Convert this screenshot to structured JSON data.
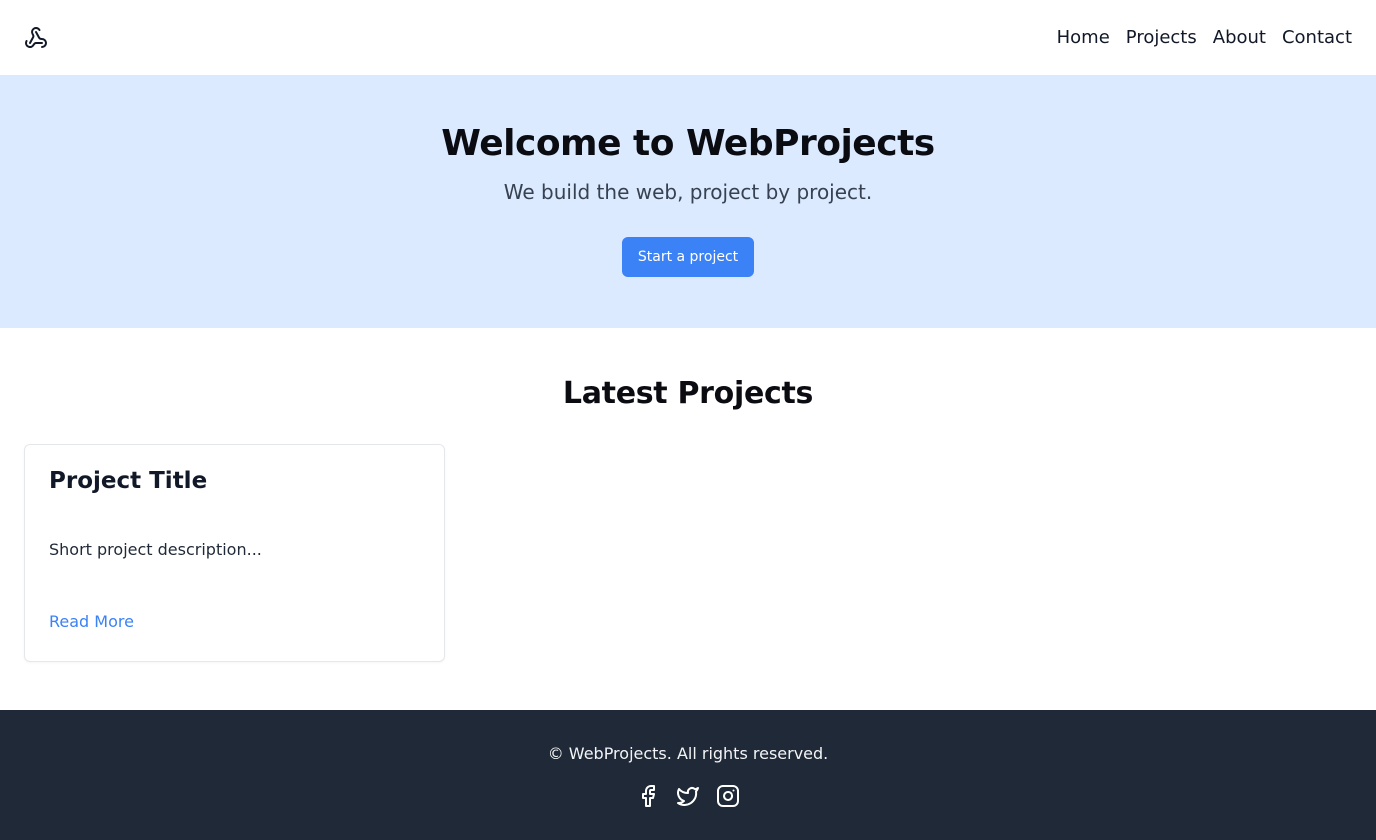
{
  "header": {
    "logo_icon": "webhook-logo-icon",
    "nav": [
      {
        "label": "Home"
      },
      {
        "label": "Projects"
      },
      {
        "label": "About"
      },
      {
        "label": "Contact"
      }
    ]
  },
  "hero": {
    "title": "Welcome to WebProjects",
    "subtitle": "We build the web, project by project.",
    "cta_label": "Start a project"
  },
  "projects": {
    "heading": "Latest Projects",
    "cards": [
      {
        "title": "Project Title",
        "description": "Short project description...",
        "link_label": "Read More"
      }
    ]
  },
  "footer": {
    "copyright": "© WebProjects. All rights reserved.",
    "social_icons": [
      "facebook-icon",
      "twitter-icon",
      "instagram-icon"
    ]
  },
  "colors": {
    "accent": "#3b82f6",
    "hero_bg": "#dbeafe",
    "footer_bg": "#1f2937"
  }
}
